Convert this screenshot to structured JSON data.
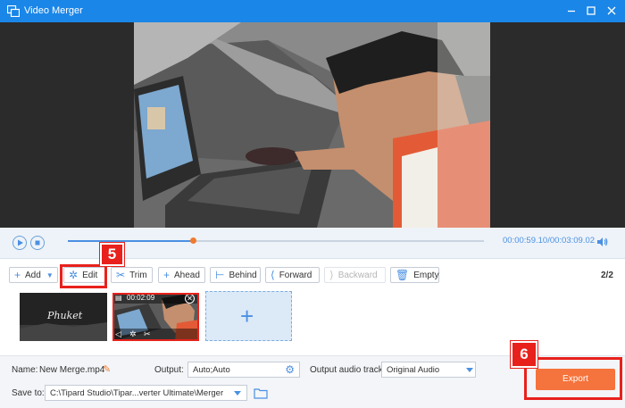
{
  "app": {
    "title": "Video Merger"
  },
  "playback": {
    "current_time": "00:00:59.10",
    "total_time": "/00:03:09.02",
    "progress": 0.3
  },
  "toolbar": {
    "add_label": "Add",
    "edit_label": "Edit",
    "trim_label": "Trim",
    "ahead_label": "Ahead",
    "behind_label": "Behind",
    "forward_label": "Forward",
    "backward_label": "Backward",
    "empty_label": "Empty",
    "page_indicator": "2/2"
  },
  "callouts": {
    "step_edit": "5",
    "step_export": "6"
  },
  "clips": [
    {
      "title_text": "Phuket"
    },
    {
      "duration": "00:02:09"
    }
  ],
  "output_settings": {
    "name_label": "Name:",
    "name_value": "New Merge.mp4",
    "output_label": "Output:",
    "output_value": "Auto;Auto",
    "audio_track_label": "Output audio track:",
    "audio_track_value": "Original Audio",
    "save_to_label": "Save to:",
    "save_to_value": "C:\\Tipard Studio\\Tipar...verter Ultimate\\Merger",
    "export_label": "Export"
  },
  "colors": {
    "titlebar": "#1a86e8",
    "accent": "#4a90e2",
    "export": "#f5733c",
    "callout": "#e8211c"
  }
}
